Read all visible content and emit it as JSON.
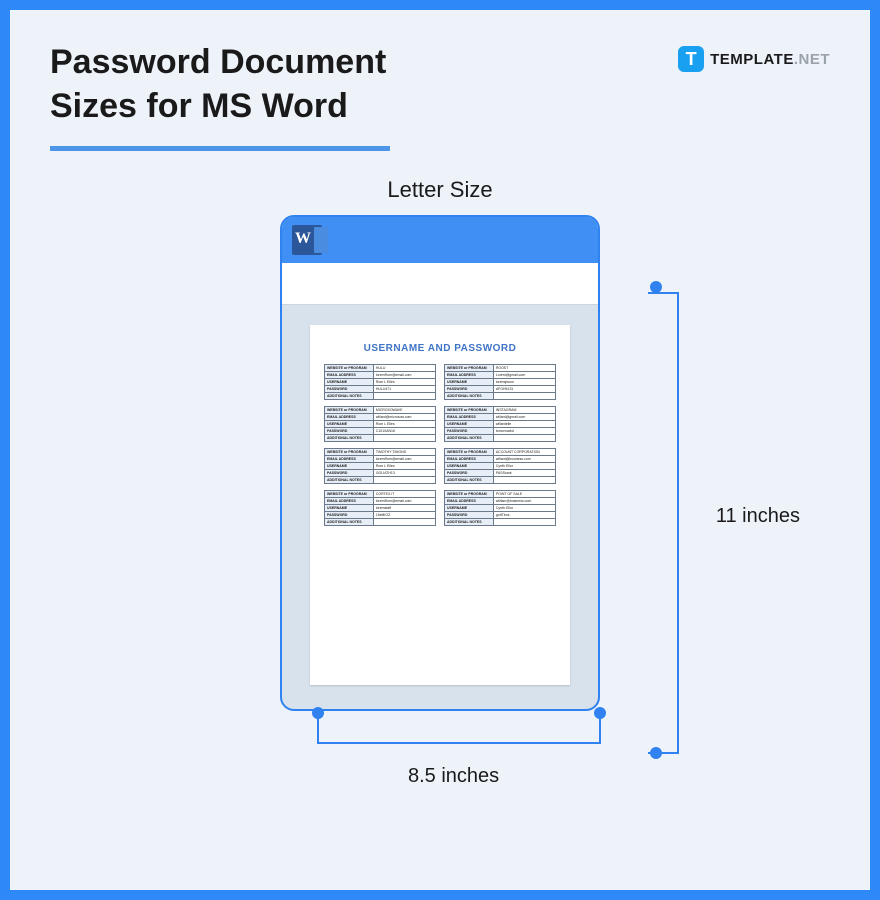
{
  "header": {
    "title_line1": "Password Document",
    "title_line2": "Sizes for MS Word"
  },
  "brand": {
    "icon_letter": "T",
    "name_main": "TEMPLATE",
    "name_suffix": ".NET"
  },
  "size_label": "Letter Size",
  "document": {
    "title": "USERNAME AND PASSWORD",
    "row_labels": [
      "WEBSITE or PROGRAM",
      "EMAIL ADDRESS",
      "USERNAME",
      "PASSWORD",
      "ADDITIONAL NOTES"
    ],
    "blocks": [
      {
        "program": "HULU",
        "email": "loremRom@email.com",
        "user": "Rom L Elles",
        "pass": "HULU471",
        "notes": ""
      },
      {
        "program": "ROOST",
        "email": "Lorem@gmail.com",
        "user": "loremipsum",
        "pass": "AFGH5131",
        "notes": ""
      },
      {
        "program": "MICROSOWAVE",
        "email": "willard@microsow.com",
        "user": "Rom L Elles",
        "pass": "C1010AN16",
        "notes": ""
      },
      {
        "program": "INSTAGRAM",
        "email": "willard@gmail.com",
        "user": "willardelle",
        "pass": "tomorrowlol",
        "notes": ""
      },
      {
        "program": "TIMOTHY TIMONS",
        "email": "loremRom@email.com",
        "user": "Rom L Elles",
        "pass": "GOLIATH13",
        "notes": ""
      },
      {
        "program": "ACCOUNT CORPORATION",
        "email": "willard@business.com",
        "user": "Cynth Ellor",
        "pass": "PASScant",
        "notes": ""
      },
      {
        "program": "CORTEX.IT",
        "email": "loremRom@email.com",
        "user": "loremstaff",
        "pass": "15elfIIOZ",
        "notes": ""
      },
      {
        "program": "POINT OF SALE",
        "email": "william@business.com",
        "user": "Cynth Ellor",
        "pass": "gotITbos",
        "notes": ""
      }
    ]
  },
  "dimensions": {
    "height": "11 inches",
    "width": "8.5 inches"
  }
}
